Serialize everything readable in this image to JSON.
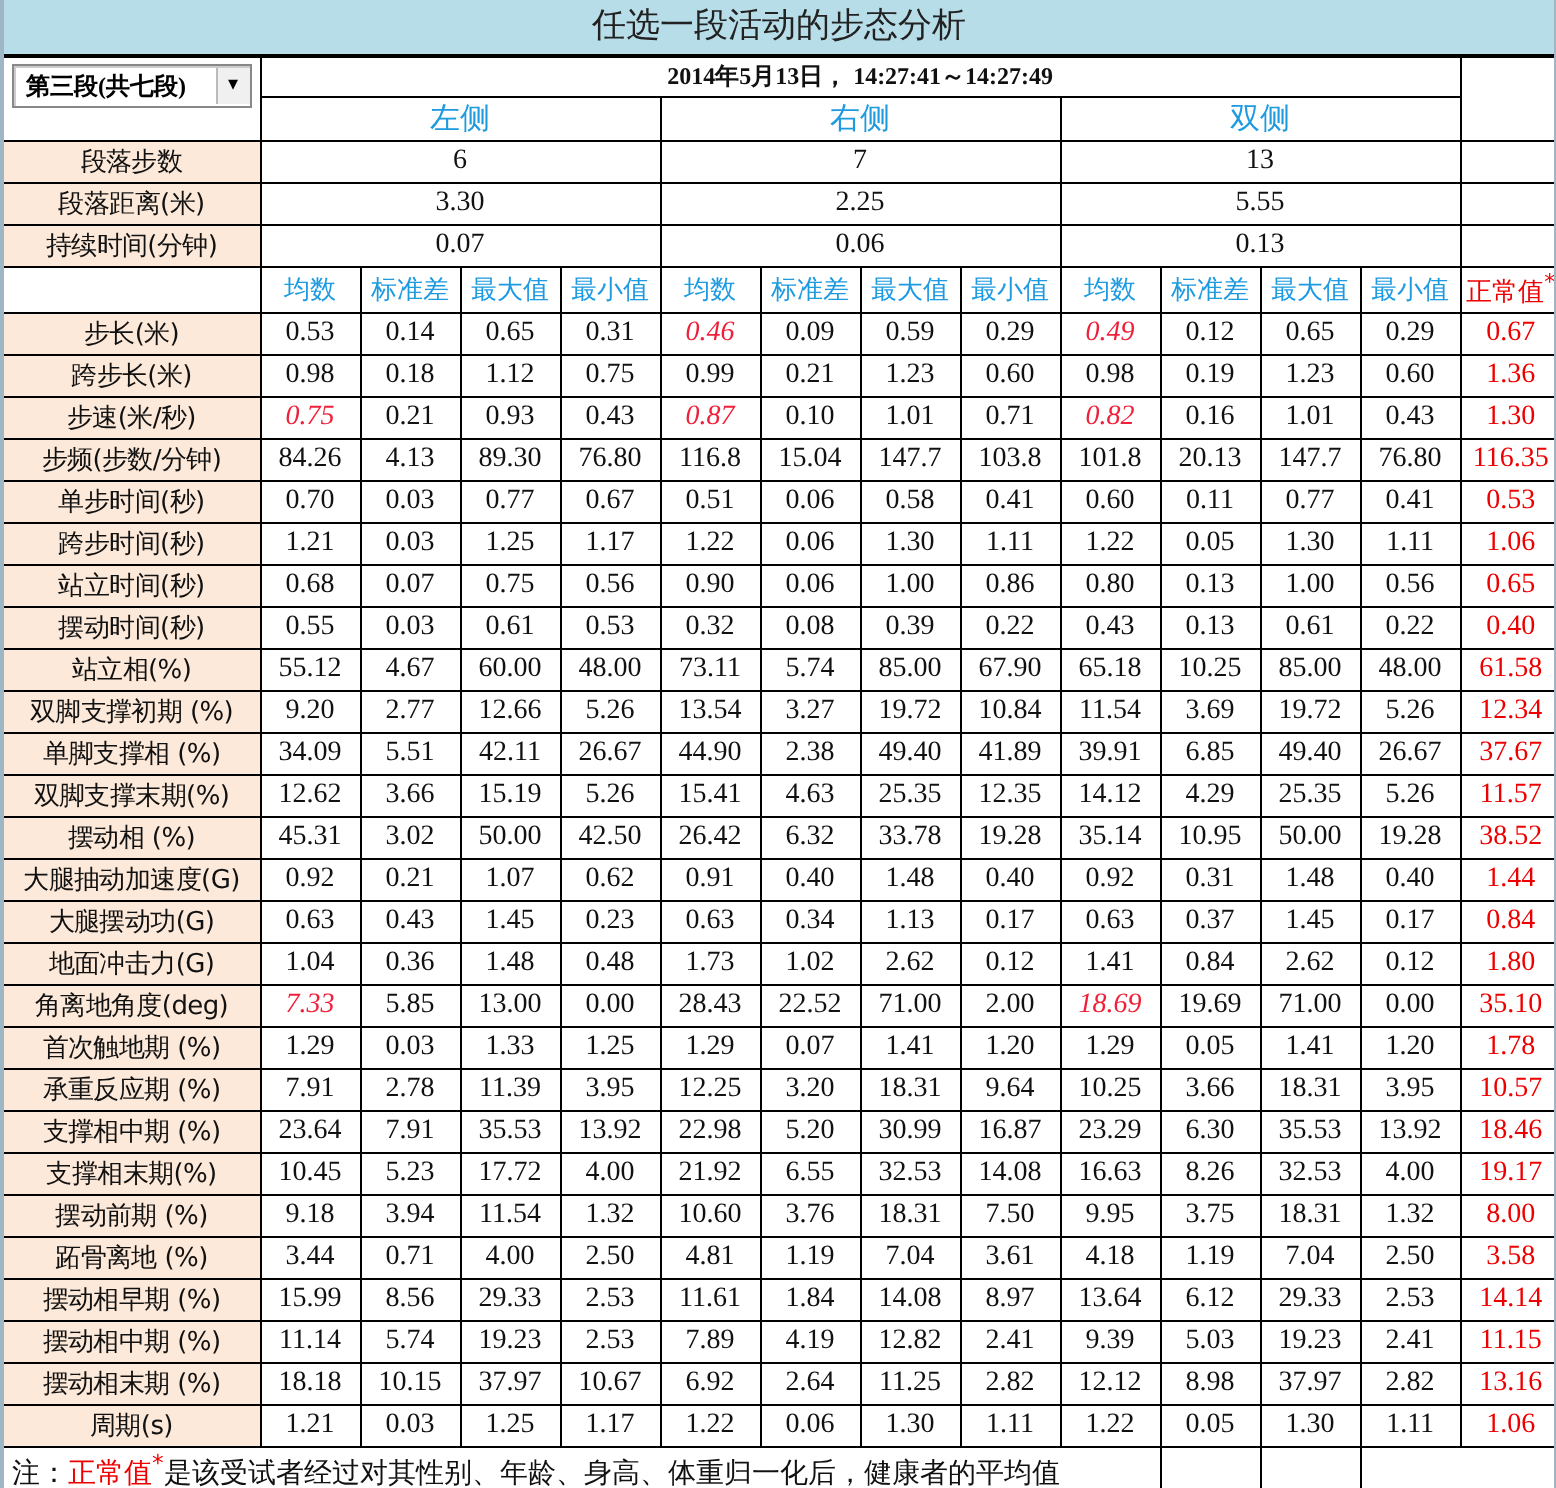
{
  "title": "任选一段活动的步态分析",
  "segment_select": {
    "value": "第三段(共七段)",
    "arrow": "▾"
  },
  "date_range": "2014年5月13日， 14:27:41～14:27:49",
  "sides": [
    "左侧",
    "右侧",
    "双侧"
  ],
  "summary_rows": [
    {
      "label": "段落步数",
      "values": [
        "6",
        "7",
        "13"
      ]
    },
    {
      "label": "段落距离(米)",
      "values": [
        "3.30",
        "2.25",
        "5.55"
      ]
    },
    {
      "label": "持续时间(分钟)",
      "values": [
        "0.07",
        "0.06",
        "0.13"
      ]
    }
  ],
  "stat_columns": [
    "均数",
    "标准差",
    "最大值",
    "最小值",
    "均数",
    "标准差",
    "最大值",
    "最小值",
    "均数",
    "标准差",
    "最大值",
    "最小值"
  ],
  "normal_column": "正常值$^{*}$",
  "rows": [
    {
      "label": "步长(米)",
      "values": [
        "0.53",
        "0.14",
        "0.65",
        "0.31",
        "0.46",
        "0.09",
        "0.59",
        "0.29",
        "0.49",
        "0.12",
        "0.65",
        "0.29"
      ],
      "flagged": [
        false,
        false,
        false,
        false,
        true,
        false,
        false,
        false,
        true,
        false,
        false,
        false
      ],
      "normal": "0.67"
    },
    {
      "label": "跨步长(米)",
      "values": [
        "0.98",
        "0.18",
        "1.12",
        "0.75",
        "0.99",
        "0.21",
        "1.23",
        "0.60",
        "0.98",
        "0.19",
        "1.23",
        "0.60"
      ],
      "flagged": [
        false,
        false,
        false,
        false,
        false,
        false,
        false,
        false,
        false,
        false,
        false,
        false
      ],
      "normal": "1.36"
    },
    {
      "label": "步速(米/秒)",
      "values": [
        "0.75",
        "0.21",
        "0.93",
        "0.43",
        "0.87",
        "0.10",
        "1.01",
        "0.71",
        "0.82",
        "0.16",
        "1.01",
        "0.43"
      ],
      "flagged": [
        true,
        false,
        false,
        false,
        true,
        false,
        false,
        false,
        true,
        false,
        false,
        false
      ],
      "normal": "1.30"
    },
    {
      "label": "步频(步数/分钟)",
      "values": [
        "84.26",
        "4.13",
        "89.30",
        "76.80",
        "116.8",
        "15.04",
        "147.7",
        "103.8",
        "101.8",
        "20.13",
        "147.7",
        "76.80"
      ],
      "flagged": [
        false,
        false,
        false,
        false,
        false,
        false,
        false,
        false,
        false,
        false,
        false,
        false
      ],
      "normal": "116.35"
    },
    {
      "label": "单步时间(秒)",
      "values": [
        "0.70",
        "0.03",
        "0.77",
        "0.67",
        "0.51",
        "0.06",
        "0.58",
        "0.41",
        "0.60",
        "0.11",
        "0.77",
        "0.41"
      ],
      "flagged": [
        false,
        false,
        false,
        false,
        false,
        false,
        false,
        false,
        false,
        false,
        false,
        false
      ],
      "normal": "0.53"
    },
    {
      "label": "跨步时间(秒)",
      "values": [
        "1.21",
        "0.03",
        "1.25",
        "1.17",
        "1.22",
        "0.06",
        "1.30",
        "1.11",
        "1.22",
        "0.05",
        "1.30",
        "1.11"
      ],
      "flagged": [
        false,
        false,
        false,
        false,
        false,
        false,
        false,
        false,
        false,
        false,
        false,
        false
      ],
      "normal": "1.06"
    },
    {
      "label": "站立时间(秒)",
      "values": [
        "0.68",
        "0.07",
        "0.75",
        "0.56",
        "0.90",
        "0.06",
        "1.00",
        "0.86",
        "0.80",
        "0.13",
        "1.00",
        "0.56"
      ],
      "flagged": [
        false,
        false,
        false,
        false,
        false,
        false,
        false,
        false,
        false,
        false,
        false,
        false
      ],
      "normal": "0.65"
    },
    {
      "label": "摆动时间(秒)",
      "values": [
        "0.55",
        "0.03",
        "0.61",
        "0.53",
        "0.32",
        "0.08",
        "0.39",
        "0.22",
        "0.43",
        "0.13",
        "0.61",
        "0.22"
      ],
      "flagged": [
        false,
        false,
        false,
        false,
        false,
        false,
        false,
        false,
        false,
        false,
        false,
        false
      ],
      "normal": "0.40"
    },
    {
      "label": "站立相(%)",
      "values": [
        "55.12",
        "4.67",
        "60.00",
        "48.00",
        "73.11",
        "5.74",
        "85.00",
        "67.90",
        "65.18",
        "10.25",
        "85.00",
        "48.00"
      ],
      "flagged": [
        false,
        false,
        false,
        false,
        false,
        false,
        false,
        false,
        false,
        false,
        false,
        false
      ],
      "normal": "61.58"
    },
    {
      "label": "双脚支撑初期 (%)",
      "values": [
        "9.20",
        "2.77",
        "12.66",
        "5.26",
        "13.54",
        "3.27",
        "19.72",
        "10.84",
        "11.54",
        "3.69",
        "19.72",
        "5.26"
      ],
      "flagged": [
        false,
        false,
        false,
        false,
        false,
        false,
        false,
        false,
        false,
        false,
        false,
        false
      ],
      "normal": "12.34"
    },
    {
      "label": "单脚支撑相 (%)",
      "values": [
        "34.09",
        "5.51",
        "42.11",
        "26.67",
        "44.90",
        "2.38",
        "49.40",
        "41.89",
        "39.91",
        "6.85",
        "49.40",
        "26.67"
      ],
      "flagged": [
        false,
        false,
        false,
        false,
        false,
        false,
        false,
        false,
        false,
        false,
        false,
        false
      ],
      "normal": "37.67"
    },
    {
      "label": "双脚支撑末期(%)",
      "values": [
        "12.62",
        "3.66",
        "15.19",
        "5.26",
        "15.41",
        "4.63",
        "25.35",
        "12.35",
        "14.12",
        "4.29",
        "25.35",
        "5.26"
      ],
      "flagged": [
        false,
        false,
        false,
        false,
        false,
        false,
        false,
        false,
        false,
        false,
        false,
        false
      ],
      "normal": "11.57"
    },
    {
      "label": "摆动相 (%)",
      "values": [
        "45.31",
        "3.02",
        "50.00",
        "42.50",
        "26.42",
        "6.32",
        "33.78",
        "19.28",
        "35.14",
        "10.95",
        "50.00",
        "19.28"
      ],
      "flagged": [
        false,
        false,
        false,
        false,
        false,
        false,
        false,
        false,
        false,
        false,
        false,
        false
      ],
      "normal": "38.52"
    },
    {
      "label": "大腿抽动加速度(G)",
      "values": [
        "0.92",
        "0.21",
        "1.07",
        "0.62",
        "0.91",
        "0.40",
        "1.48",
        "0.40",
        "0.92",
        "0.31",
        "1.48",
        "0.40"
      ],
      "flagged": [
        false,
        false,
        false,
        false,
        false,
        false,
        false,
        false,
        false,
        false,
        false,
        false
      ],
      "normal": "1.44"
    },
    {
      "label": "大腿摆动功(G)",
      "values": [
        "0.63",
        "0.43",
        "1.45",
        "0.23",
        "0.63",
        "0.34",
        "1.13",
        "0.17",
        "0.63",
        "0.37",
        "1.45",
        "0.17"
      ],
      "flagged": [
        false,
        false,
        false,
        false,
        false,
        false,
        false,
        false,
        false,
        false,
        false,
        false
      ],
      "normal": "0.84"
    },
    {
      "label": "地面冲击力(G)",
      "values": [
        "1.04",
        "0.36",
        "1.48",
        "0.48",
        "1.73",
        "1.02",
        "2.62",
        "0.12",
        "1.41",
        "0.84",
        "2.62",
        "0.12"
      ],
      "flagged": [
        false,
        false,
        false,
        false,
        false,
        false,
        false,
        false,
        false,
        false,
        false,
        false
      ],
      "normal": "1.80"
    },
    {
      "label": "角离地角度(deg)",
      "values": [
        "7.33",
        "5.85",
        "13.00",
        "0.00",
        "28.43",
        "22.52",
        "71.00",
        "2.00",
        "18.69",
        "19.69",
        "71.00",
        "0.00"
      ],
      "flagged": [
        true,
        false,
        false,
        false,
        false,
        false,
        false,
        false,
        true,
        false,
        false,
        false
      ],
      "normal": "35.10"
    },
    {
      "label": "首次触地期 (%)",
      "values": [
        "1.29",
        "0.03",
        "1.33",
        "1.25",
        "1.29",
        "0.07",
        "1.41",
        "1.20",
        "1.29",
        "0.05",
        "1.41",
        "1.20"
      ],
      "flagged": [
        false,
        false,
        false,
        false,
        false,
        false,
        false,
        false,
        false,
        false,
        false,
        false
      ],
      "normal": "1.78"
    },
    {
      "label": "承重反应期 (%)",
      "values": [
        "7.91",
        "2.78",
        "11.39",
        "3.95",
        "12.25",
        "3.20",
        "18.31",
        "9.64",
        "10.25",
        "3.66",
        "18.31",
        "3.95"
      ],
      "flagged": [
        false,
        false,
        false,
        false,
        false,
        false,
        false,
        false,
        false,
        false,
        false,
        false
      ],
      "normal": "10.57"
    },
    {
      "label": "支撑相中期 (%)",
      "values": [
        "23.64",
        "7.91",
        "35.53",
        "13.92",
        "22.98",
        "5.20",
        "30.99",
        "16.87",
        "23.29",
        "6.30",
        "35.53",
        "13.92"
      ],
      "flagged": [
        false,
        false,
        false,
        false,
        false,
        false,
        false,
        false,
        false,
        false,
        false,
        false
      ],
      "normal": "18.46"
    },
    {
      "label": "支撑相末期(%)",
      "values": [
        "10.45",
        "5.23",
        "17.72",
        "4.00",
        "21.92",
        "6.55",
        "32.53",
        "14.08",
        "16.63",
        "8.26",
        "32.53",
        "4.00"
      ],
      "flagged": [
        false,
        false,
        false,
        false,
        false,
        false,
        false,
        false,
        false,
        false,
        false,
        false
      ],
      "normal": "19.17"
    },
    {
      "label": "摆动前期 (%)",
      "values": [
        "9.18",
        "3.94",
        "11.54",
        "1.32",
        "10.60",
        "3.76",
        "18.31",
        "7.50",
        "9.95",
        "3.75",
        "18.31",
        "1.32"
      ],
      "flagged": [
        false,
        false,
        false,
        false,
        false,
        false,
        false,
        false,
        false,
        false,
        false,
        false
      ],
      "normal": "8.00"
    },
    {
      "label": "跖骨离地 (%)",
      "values": [
        "3.44",
        "0.71",
        "4.00",
        "2.50",
        "4.81",
        "1.19",
        "7.04",
        "3.61",
        "4.18",
        "1.19",
        "7.04",
        "2.50"
      ],
      "flagged": [
        false,
        false,
        false,
        false,
        false,
        false,
        false,
        false,
        false,
        false,
        false,
        false
      ],
      "normal": "3.58"
    },
    {
      "label": "摆动相早期 (%)",
      "values": [
        "15.99",
        "8.56",
        "29.33",
        "2.53",
        "11.61",
        "1.84",
        "14.08",
        "8.97",
        "13.64",
        "6.12",
        "29.33",
        "2.53"
      ],
      "flagged": [
        false,
        false,
        false,
        false,
        false,
        false,
        false,
        false,
        false,
        false,
        false,
        false
      ],
      "normal": "14.14"
    },
    {
      "label": "摆动相中期 (%)",
      "values": [
        "11.14",
        "5.74",
        "19.23",
        "2.53",
        "7.89",
        "4.19",
        "12.82",
        "2.41",
        "9.39",
        "5.03",
        "19.23",
        "2.41"
      ],
      "flagged": [
        false,
        false,
        false,
        false,
        false,
        false,
        false,
        false,
        false,
        false,
        false,
        false
      ],
      "normal": "11.15"
    },
    {
      "label": "摆动相末期 (%)",
      "values": [
        "18.18",
        "10.15",
        "37.97",
        "10.67",
        "6.92",
        "2.64",
        "11.25",
        "2.82",
        "12.12",
        "8.98",
        "37.97",
        "2.82"
      ],
      "flagged": [
        false,
        false,
        false,
        false,
        false,
        false,
        false,
        false,
        false,
        false,
        false,
        false
      ],
      "normal": "13.16"
    },
    {
      "label": "周期(s)",
      "values": [
        "1.21",
        "0.03",
        "1.25",
        "1.17",
        "1.22",
        "0.06",
        "1.30",
        "1.11",
        "1.22",
        "0.05",
        "1.30",
        "1.11"
      ],
      "flagged": [
        false,
        false,
        false,
        false,
        false,
        false,
        false,
        false,
        false,
        false,
        false,
        false
      ],
      "normal": "1.06"
    }
  ],
  "note": {
    "prefix": "注：",
    "term": "正常值$^{*}$",
    "text": "是该受试者经过对其性别、年龄、身高、体重归一化后，健康者的平均值"
  }
}
